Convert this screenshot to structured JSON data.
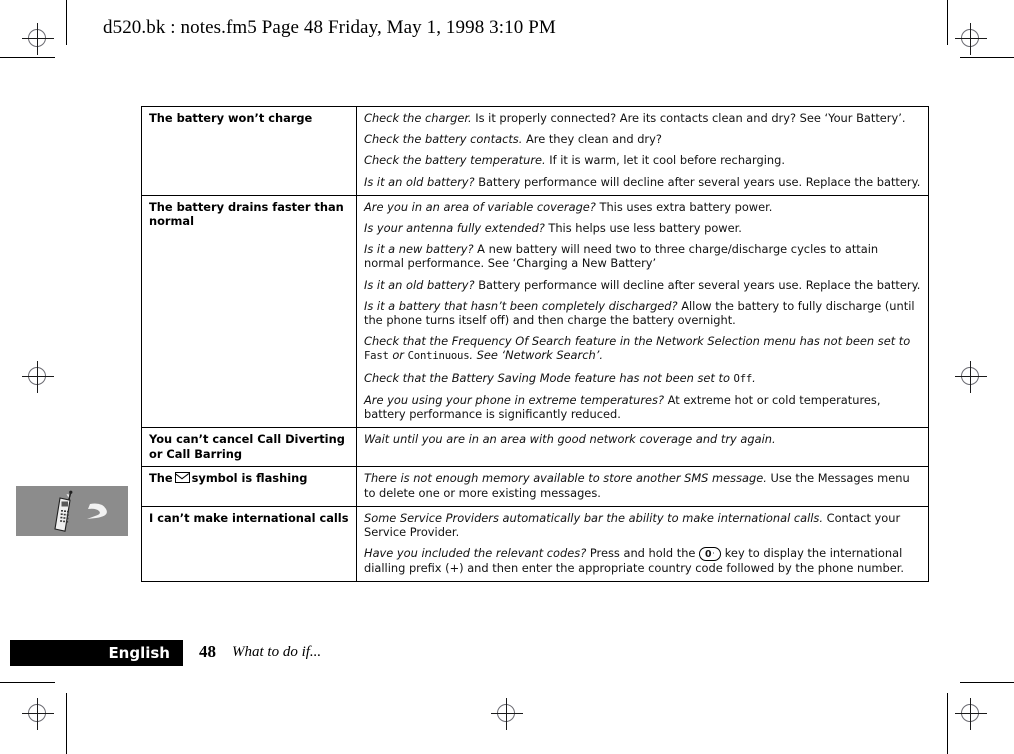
{
  "header": {
    "text": "d520.bk : notes.fm5  Page 48  Friday, May 1, 1998  3:10 PM"
  },
  "sidebar_tab": {
    "icon": "mobile-phone-icon",
    "background_color": "#8c8c8c"
  },
  "table": {
    "rows": [
      {
        "symptom": "The battery won’t charge",
        "answers": [
          {
            "question": "Check the charger.",
            "body": " Is it properly connected? Are its contacts clean and dry? See ‘Your Battery’."
          },
          {
            "question": "Check the battery contacts.",
            "body": " Are they clean and dry?"
          },
          {
            "question": "Check the battery temperature.",
            "body": " If it is warm, let it cool before recharging."
          },
          {
            "question": "Is it an old battery?",
            "body": " Battery performance will decline after several years use. Replace the battery."
          }
        ]
      },
      {
        "symptom": "The battery drains faster than normal",
        "answers": [
          {
            "question": "Are you in an area of variable coverage?",
            "body": " This uses extra battery power."
          },
          {
            "question": "Is your antenna fully extended?",
            "body": " This helps use less battery power."
          },
          {
            "question": "Is it a new battery?",
            "body": " A new battery will need two to three charge/discharge cycles to attain normal performance. See ‘Charging a New Battery’"
          },
          {
            "question": "Is it an old battery?",
            "body": " Battery performance will decline after several years use. Replace the battery."
          },
          {
            "question": "Is it a battery that hasn’t been completely discharged?",
            "body": " Allow the battery to fully discharge (until the phone turns itself off) and then charge the battery overnight."
          },
          {
            "question": "Check that the Frequency Of Search feature in the Network Selection menu has not been set to ",
            "mono1": "Fast",
            "mid": " or ",
            "mono2": "Continuous",
            "body": ". See ‘Network Search’."
          },
          {
            "question": "Check that the Battery Saving Mode feature has not been set to ",
            "mono1": "Off",
            "body": "."
          },
          {
            "question": "Are you using your phone in extreme temperatures?",
            "body": " At extreme hot or cold temperatures, battery performance is significantly reduced."
          }
        ]
      },
      {
        "symptom": "You can’t cancel Call Diverting or Call Barring",
        "answers": [
          {
            "question": "Wait until you are in an area with good network coverage and try again.",
            "body": ""
          }
        ]
      },
      {
        "symptom_prefix": "The",
        "symptom_icon": "envelope-icon",
        "symptom_suffix": "symbol is flashing",
        "answers": [
          {
            "question": "There is not enough memory available to store another SMS message.",
            "body": " Use the Messages menu to delete one or more existing messages."
          }
        ]
      },
      {
        "symptom": "I can’t make international calls",
        "answers": [
          {
            "question": "Some Service Providers automatically bar the ability to make international calls.",
            "body": " Contact your Service Provider."
          },
          {
            "question": "Have you included the relevant codes?",
            "body_before_key": " Press and hold the ",
            "key_label": "0",
            "key_dot": "·",
            "body_after_key": " key to display the international dialling prefix (+) and then enter the appropriate country code followed by the phone number."
          }
        ]
      }
    ]
  },
  "footer": {
    "language": "English",
    "page_number": "48",
    "section": "What to do if..."
  }
}
